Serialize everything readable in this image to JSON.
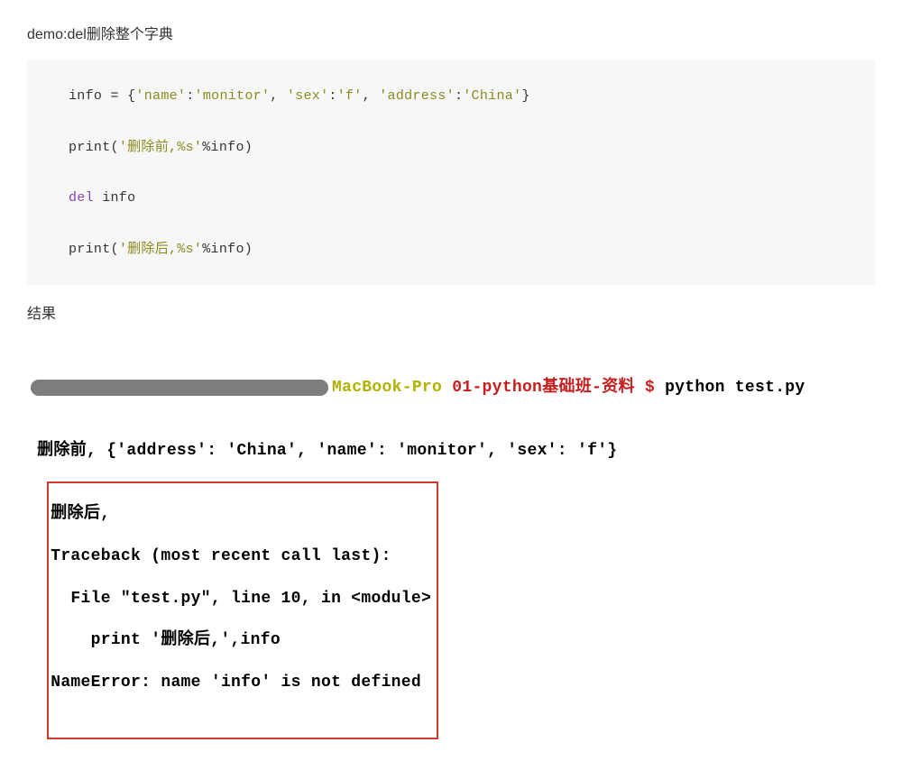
{
  "heading": "demo:del删除整个字典",
  "code": {
    "l1_pre": "info = {",
    "l1_s1": "'name'",
    "l1_c1": ":",
    "l1_s2": "'monitor'",
    "l1_c2": ", ",
    "l1_s3": "'sex'",
    "l1_c3": ":",
    "l1_s4": "'f'",
    "l1_c4": ", ",
    "l1_s5": "'address'",
    "l1_c5": ":",
    "l1_s6": "'China'",
    "l1_post": "}",
    "l2_pre": "print(",
    "l2_s1": "'删除前,%s'",
    "l2_post": "%info)",
    "l3_kw": "del",
    "l3_post": " info",
    "l4_pre": "print(",
    "l4_s1": "'删除后,%s'",
    "l4_post": "%info)"
  },
  "result_label": "结果",
  "terminal": {
    "host": "MacBook-Pro ",
    "dir": "01-python基础班-资料",
    "prompt": " $ ",
    "cmd": "python test.py",
    "out1": " 删除前, {'address': 'China', 'name': 'monitor', 'sex': 'f'}",
    "err1": "删除后,",
    "err2": "Traceback (most recent call last):",
    "err3": "  File \"test.py\", line 10, in <module>",
    "err4": "    print '删除后,',info",
    "err5": "NameError: name 'info' is not defined"
  }
}
